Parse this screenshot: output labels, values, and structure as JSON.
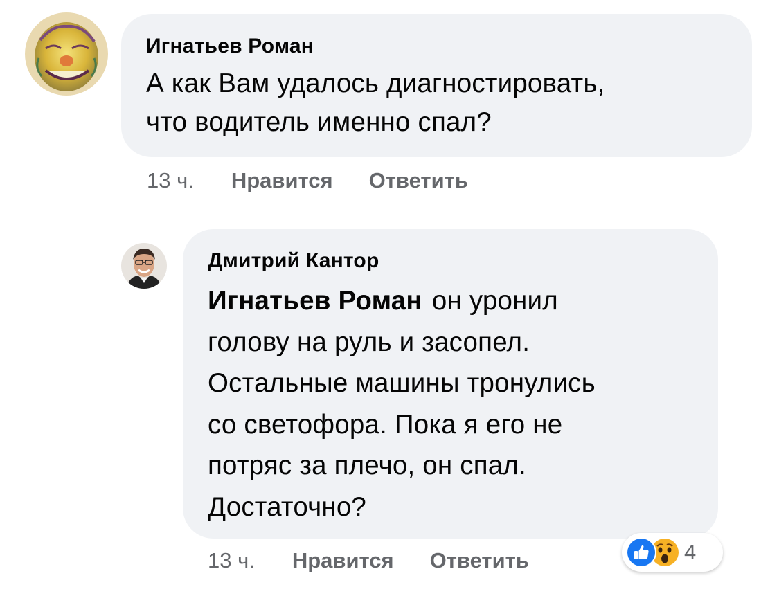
{
  "comments": [
    {
      "author": "Игнатьев Роман",
      "lines": [
        "А как Вам удалось диагностировать,",
        "что водитель именно спал?"
      ],
      "time": "13 ч.",
      "like_label": "Нравится",
      "reply_label": "Ответить"
    },
    {
      "author": "Дмитрий Кантор",
      "mention": "Игнатьев Роман",
      "lines": [
        "он уронил",
        "голову на руль и засопел.",
        "Остальные машины тронулись",
        "со светофора. Пока я его не",
        "потряс за плечо, он спал.",
        "Достаточно?"
      ],
      "time": "13 ч.",
      "like_label": "Нравится",
      "reply_label": "Ответить",
      "reactions": {
        "icons": [
          "like-icon",
          "wow-icon"
        ],
        "count": "4"
      }
    }
  ],
  "colors": {
    "bubble": "#f0f2f5",
    "meta": "#65676b",
    "like_blue": "#1877f2",
    "wow_yellow": "#f7b125"
  }
}
